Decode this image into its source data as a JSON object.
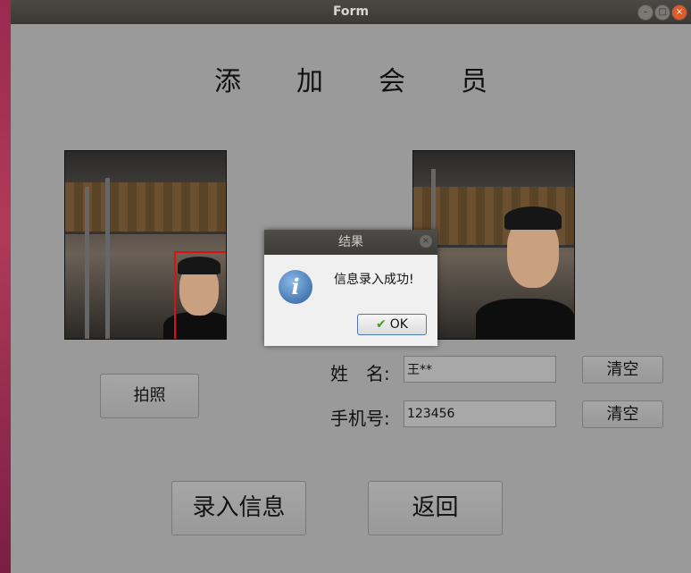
{
  "window": {
    "title": "Form"
  },
  "heading": "添加会员",
  "buttons": {
    "take_photo": "拍照",
    "clear_name": "清空",
    "clear_phone": "清空",
    "submit": "录入信息",
    "back": "返回"
  },
  "form": {
    "name_label": "姓　名:",
    "name_value": "王**",
    "phone_label": "手机号:",
    "phone_value": "123456"
  },
  "dialog": {
    "title": "结果",
    "message": "信息录入成功!",
    "ok_label": "OK",
    "icon": "info-icon"
  },
  "colors": {
    "window_bg": "#9a9a9a",
    "titlebar": "#3d3c38",
    "face_box": "#e01010",
    "close_button": "#e05a2a"
  }
}
